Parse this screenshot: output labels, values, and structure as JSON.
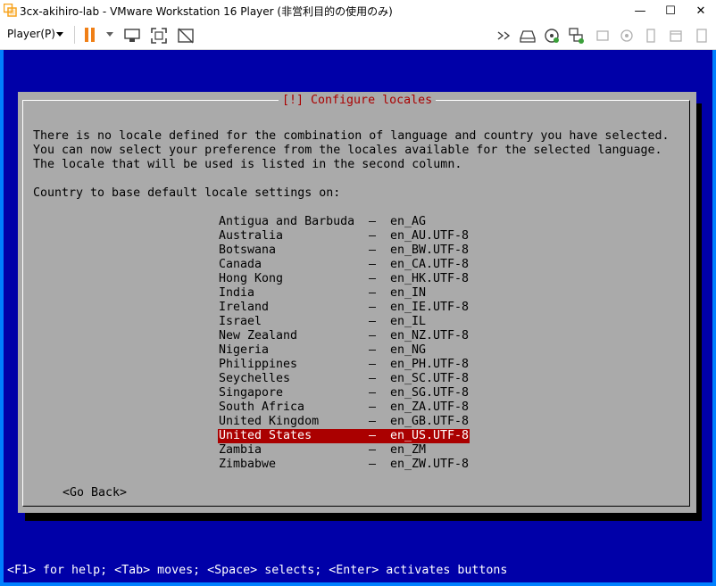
{
  "window": {
    "title": "3cx-akihiro-lab - VMware Workstation 16 Player (非営利目的の使用のみ)",
    "minimize_glyph": "—",
    "maximize_glyph": "☐",
    "close_glyph": "✕"
  },
  "toolbar": {
    "player_menu": "Player(P)"
  },
  "dialog": {
    "title": "[!] Configure locales",
    "paragraph": "There is no locale defined for the combination of language and country you have selected.\nYou can now select your preference from the locales available for the selected language.\nThe locale that will be used is listed in the second column.",
    "prompt": "Country to base default locale settings on:",
    "separator": "–",
    "items": [
      {
        "country": "Antigua and Barbuda",
        "locale": "en_AG"
      },
      {
        "country": "Australia",
        "locale": "en_AU.UTF-8"
      },
      {
        "country": "Botswana",
        "locale": "en_BW.UTF-8"
      },
      {
        "country": "Canada",
        "locale": "en_CA.UTF-8"
      },
      {
        "country": "Hong Kong",
        "locale": "en_HK.UTF-8"
      },
      {
        "country": "India",
        "locale": "en_IN"
      },
      {
        "country": "Ireland",
        "locale": "en_IE.UTF-8"
      },
      {
        "country": "Israel",
        "locale": "en_IL"
      },
      {
        "country": "New Zealand",
        "locale": "en_NZ.UTF-8"
      },
      {
        "country": "Nigeria",
        "locale": "en_NG"
      },
      {
        "country": "Philippines",
        "locale": "en_PH.UTF-8"
      },
      {
        "country": "Seychelles",
        "locale": "en_SC.UTF-8"
      },
      {
        "country": "Singapore",
        "locale": "en_SG.UTF-8"
      },
      {
        "country": "South Africa",
        "locale": "en_ZA.UTF-8"
      },
      {
        "country": "United Kingdom",
        "locale": "en_GB.UTF-8"
      },
      {
        "country": "United States",
        "locale": "en_US.UTF-8",
        "selected": true
      },
      {
        "country": "Zambia",
        "locale": "en_ZM"
      },
      {
        "country": "Zimbabwe",
        "locale": "en_ZW.UTF-8"
      }
    ],
    "go_back": "<Go Back>"
  },
  "status_line": "<F1> for help; <Tab> moves; <Space> selects; <Enter> activates buttons",
  "colors": {
    "screen_bg": "#0000a8",
    "dialog_bg": "#aaaaaa",
    "selection_bg": "#aa0000",
    "title_fg": "#aa0000",
    "vm_border": "#0080ff",
    "pause_orange": "#f07f16"
  },
  "icons": [
    "vmware-app-icon",
    "pause-icon",
    "send-ctrl-alt-del-icon",
    "fullscreen-icon",
    "unity-icon",
    "forward-icon",
    "hard-disk-icon",
    "cd-dvd-icon",
    "network-adapter-icon",
    "usb-icon",
    "sound-card-icon",
    "printer-icon",
    "display-icon"
  ]
}
